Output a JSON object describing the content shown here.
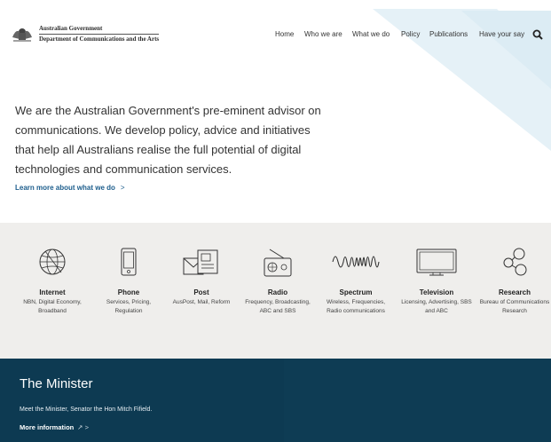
{
  "header": {
    "logo": {
      "government": "Australian Government",
      "department": "Department of Communications and the Arts"
    },
    "nav": [
      "Home",
      "Who we are",
      "What we do",
      "Policy",
      "Publications",
      "Have your say"
    ],
    "search_icon": "search-icon"
  },
  "intro": {
    "text": "We are the Australian Government's pre-eminent advisor on communications. We develop policy, advice and initiatives that help all Australians realise the full potential of digital technologies and communication services.",
    "link": "Learn more about what we do",
    "link_chevron": ">"
  },
  "topics": [
    {
      "icon": "globe-icon",
      "title": "Internet",
      "desc": "NBN, Digital Economy, Broadband"
    },
    {
      "icon": "phone-icon",
      "title": "Phone",
      "desc": "Services, Pricing, Regulation"
    },
    {
      "icon": "mail-icon",
      "title": "Post",
      "desc": "AusPost, Mail, Reform"
    },
    {
      "icon": "radio-icon",
      "title": "Radio",
      "desc": "Frequency, Broadcasting, ABC and SBS"
    },
    {
      "icon": "wave-icon",
      "title": "Spectrum",
      "desc": "Wireless, Frequencies, Radio communications"
    },
    {
      "icon": "tv-icon",
      "title": "Television",
      "desc": "Licensing, Advertising, SBS and ABC"
    },
    {
      "icon": "network-icon",
      "title": "Research",
      "desc": "Bureau of Communications Research"
    }
  ],
  "minister": {
    "title": "The Minister",
    "text": "Meet the Minister, Senator the Hon Mitch Fifield.",
    "link": "More information",
    "link_suffix": "↗ >"
  },
  "colors": {
    "accent": "#1c5d8c",
    "band": "#efeeec",
    "minister_bg": "#0d3a52",
    "deco": "#e5f1f7"
  }
}
